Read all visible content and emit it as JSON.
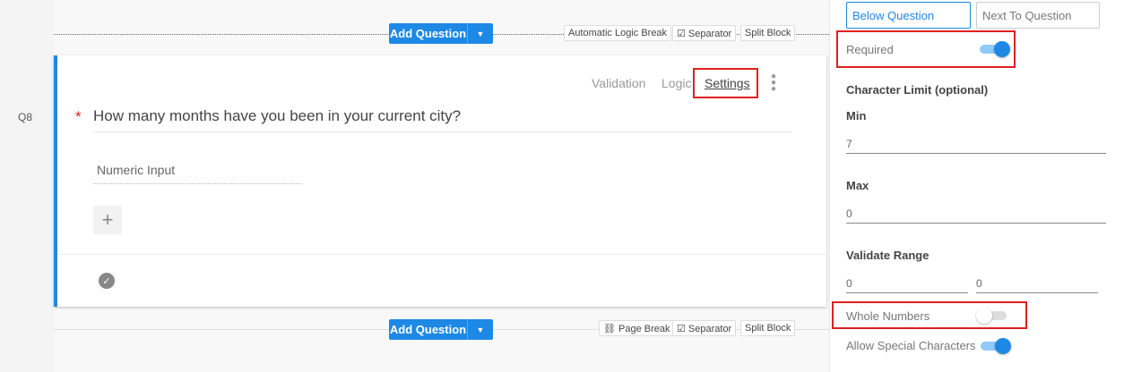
{
  "question": {
    "number": "Q8",
    "required_marker": "*",
    "text": "How many months have you been in your current city?",
    "answer_type": "Numeric Input",
    "tabs": [
      "Validation",
      "Logic",
      "Settings"
    ]
  },
  "top_bar": {
    "add_question": "Add Question",
    "chips": [
      "Automatic Logic Break",
      "☑ Separator",
      "Split Block"
    ]
  },
  "bottom_bar": {
    "add_question": "Add Question",
    "chips": [
      "⛓ Page Break",
      "☑ Separator",
      "Split Block"
    ]
  },
  "panel": {
    "position_options": [
      "Below Question",
      "Next To Question"
    ],
    "required_label": "Required",
    "required_on": true,
    "char_limit_heading": "Character Limit (optional)",
    "min_label": "Min",
    "min_value": "7",
    "max_label": "Max",
    "max_value": "0",
    "validate_range_label": "Validate Range",
    "range_from": "0",
    "range_to": "0",
    "whole_numbers_label": "Whole Numbers",
    "whole_numbers_on": false,
    "special_chars_label": "Allow Special Characters",
    "special_chars_on": true
  }
}
